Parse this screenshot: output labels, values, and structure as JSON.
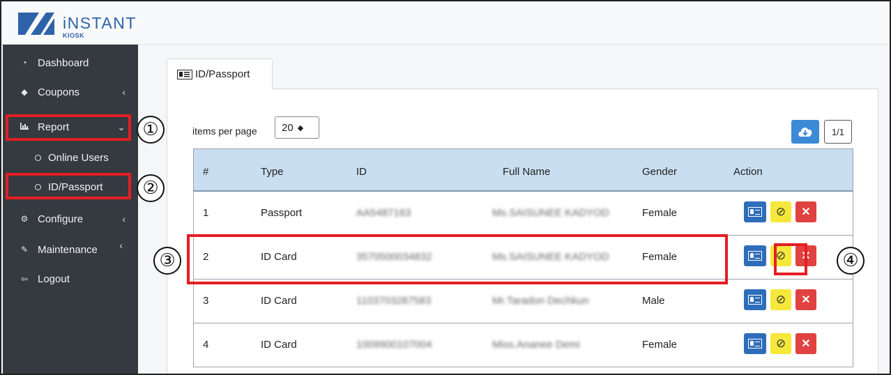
{
  "brand": {
    "name": "iNSTANT",
    "sub": "KIOSK",
    "color": "#2e63a8"
  },
  "sidebar": {
    "items": [
      {
        "label": "Dashboard",
        "icon": "speedometer-icon"
      },
      {
        "label": "Coupons",
        "icon": "tag-icon",
        "chevron": "‹"
      },
      {
        "label": "Report",
        "icon": "bar-chart-icon",
        "chevron": "⌄"
      },
      {
        "label": "Online Users",
        "icon": "circle-icon"
      },
      {
        "label": "ID/Passport",
        "icon": "circle-icon"
      },
      {
        "label": "Configure",
        "icon": "gear-icon",
        "chevron": "‹"
      },
      {
        "label": "Maintenance",
        "icon": "wrench-icon",
        "chevron": "‹"
      },
      {
        "label": "Logout",
        "icon": "logout-icon"
      }
    ]
  },
  "callouts": [
    "①",
    "②",
    "③",
    "④"
  ],
  "tab": {
    "label": "ID/Passport",
    "icon": "id-card-icon"
  },
  "pagination": {
    "items_per_page_label": "items per page",
    "items_per_page_value": "20",
    "page_label": "1/1"
  },
  "table": {
    "headers": [
      "#",
      "Type",
      "ID",
      "Full Name",
      "Gender",
      "Action"
    ],
    "rows": [
      {
        "num": "1",
        "type": "Passport",
        "id": "AA5487163",
        "full_name": "Ms.SAISUNEE KADYOD",
        "gender": "Female"
      },
      {
        "num": "2",
        "type": "ID Card",
        "id": "3570500034832",
        "full_name": "Ms.SAISUNEE KADYOD",
        "gender": "Female"
      },
      {
        "num": "3",
        "type": "ID Card",
        "id": "1103703287583",
        "full_name": "Mr.Taradon Dechkun",
        "gender": "Male"
      },
      {
        "num": "4",
        "type": "ID Card",
        "id": "1009900107004",
        "full_name": "Miss.Ananee Demi",
        "gender": "Female"
      }
    ],
    "action_icons": [
      "id-card-icon",
      "suspend-icon",
      "delete-icon"
    ]
  },
  "colors": {
    "sidebar_bg": "#343a40",
    "header_row_bg": "#c9def1",
    "highlight": "#e31e24",
    "card_btn": "#2e6dba",
    "suspend_btn": "#f5e83a",
    "delete_btn": "#e04141",
    "download_btn": "#3a8ad6"
  }
}
